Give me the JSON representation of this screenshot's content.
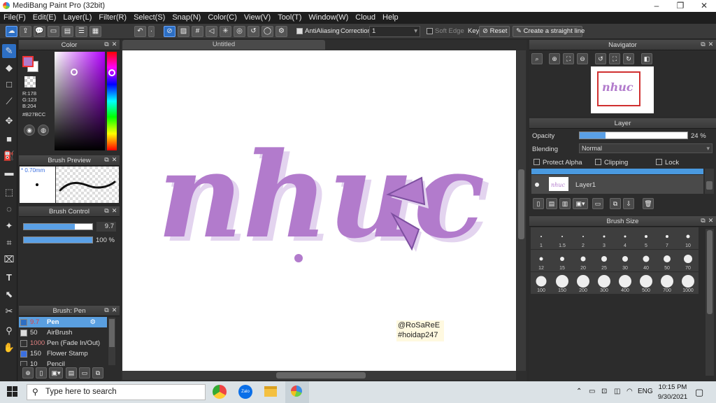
{
  "window": {
    "title": "MediBang Paint Pro (32bit)",
    "controls": [
      "–",
      "❐",
      "✕"
    ]
  },
  "menu": [
    "File(F)",
    "Edit(E)",
    "Layer(L)",
    "Filter(R)",
    "Select(S)",
    "Snap(N)",
    "Color(C)",
    "View(V)",
    "Tool(T)",
    "Window(W)",
    "Cloud",
    "Help"
  ],
  "toolbar": {
    "antialiasing_label": "AntiAliasing",
    "correction_label": "Correction",
    "correction_value": "1",
    "soft_edge_label": "Soft Edge",
    "key_label": "Key",
    "reset_label": "Reset",
    "straight_line_label": "Create a straight line"
  },
  "color_panel": {
    "title": "Color",
    "r": "R:178",
    "g": "G:123",
    "b": "B:204",
    "hex": "#B27BCC",
    "color": "#B27BCC"
  },
  "brush_preview": {
    "title": "Brush Preview",
    "size": "* 0.70mm"
  },
  "brush_control": {
    "title": "Brush Control",
    "size_value": "9.7",
    "opacity_value": "100 %",
    "size_fraction": 0.74,
    "opacity_fraction": 1.0
  },
  "brush_list": {
    "title": "Brush: Pen",
    "items": [
      {
        "size": "9.7",
        "name": "Pen",
        "color": "#2d6fc4",
        "selected": true
      },
      {
        "size": "50",
        "name": "AirBrush",
        "color": "#dddddd",
        "selected": false
      },
      {
        "size": "1000",
        "name": "Pen (Fade In/Out)",
        "color": "#333333",
        "selected": false
      },
      {
        "size": "150",
        "name": "Flower Stamp",
        "color": "#3a6fe0",
        "selected": false
      },
      {
        "size": "10",
        "name": "Pencil",
        "color": "#333333",
        "selected": false
      }
    ]
  },
  "canvas": {
    "tab_title": "Untitled",
    "artwork_text": "nhục",
    "artwork_color": "#B27BCC",
    "watermark_line1": "@RoSaReE",
    "watermark_line2": "#hoidap247"
  },
  "navigator": {
    "title": "Navigator"
  },
  "layer_panel": {
    "title": "Layer",
    "opacity_label": "Opacity",
    "opacity_value": "24 %",
    "opacity_fraction": 0.24,
    "blending_label": "Blending",
    "blending_value": "Normal",
    "protect_alpha_label": "Protect Alpha",
    "clipping_label": "Clipping",
    "lock_label": "Lock",
    "layer_name": "Layer1"
  },
  "brush_size": {
    "title": "Brush Size",
    "sizes": [
      "1",
      "1.5",
      "2",
      "3",
      "4",
      "5",
      "7",
      "10",
      "12",
      "15",
      "20",
      "25",
      "30",
      "40",
      "50",
      "70",
      "100",
      "150",
      "200",
      "300",
      "400",
      "500",
      "700",
      "1000"
    ]
  },
  "taskbar": {
    "search_placeholder": "Type here to search",
    "time": "10:15 PM",
    "date": "9/30/2021",
    "lang": "ENG"
  }
}
